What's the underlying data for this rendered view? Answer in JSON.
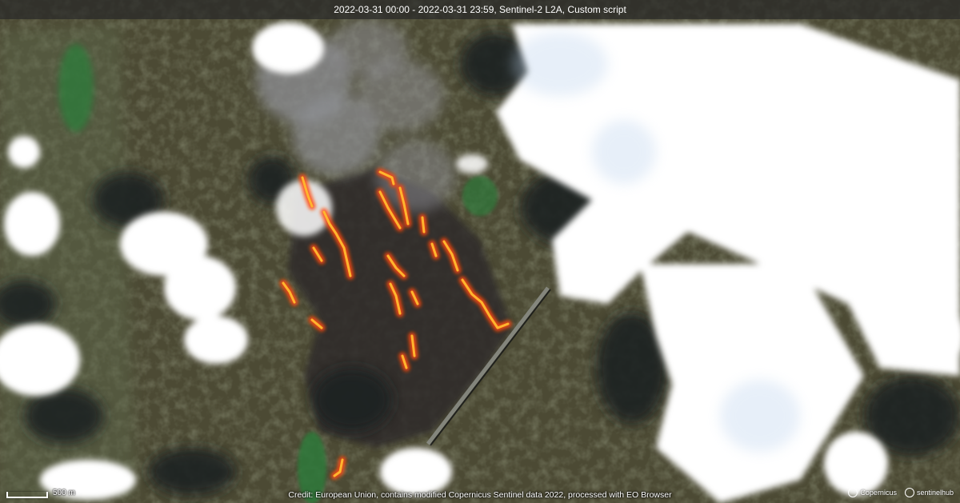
{
  "header": {
    "title": "2022-03-31 00:00 - 2022-03-31 23:59, Sentinel-2 L2A, Custom script"
  },
  "scale_bar": {
    "label": "500 m"
  },
  "footer": {
    "credit": "Credit: European Union, contains modified Copernicus Sentinel data 2022, processed with EO Browser"
  },
  "logos": [
    {
      "name": "copernicus-logo",
      "text": "Copernicus"
    },
    {
      "name": "sentinel-hub-logo",
      "text": "sentinelhub"
    }
  ],
  "colors": {
    "fire_core": "#ffd23a",
    "fire_edge": "#ff4a10",
    "land": "#4c4a34",
    "burn_scar": "#2e2a2c",
    "cloud": "#ffffff",
    "cloud_shadow": "#1e2322",
    "water": "#2f7a3a"
  }
}
